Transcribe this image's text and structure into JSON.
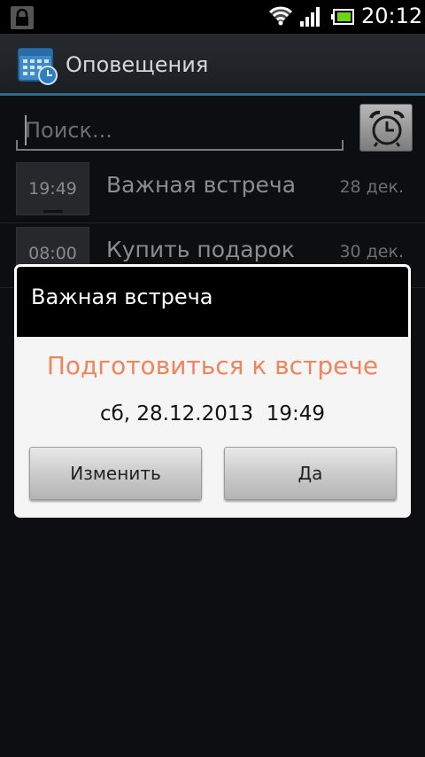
{
  "status_bar": {
    "time": "20:12",
    "icons": [
      "lock-icon",
      "wifi-icon",
      "signal-icon",
      "battery-icon"
    ]
  },
  "action_bar": {
    "title": "Оповещения",
    "icon": "calendar-clock-icon"
  },
  "search": {
    "placeholder": "Поиск...",
    "value": ""
  },
  "alarm_button": {
    "icon": "alarm-clock-icon"
  },
  "notifications": [
    {
      "time": "19:49",
      "title": "Важная встреча",
      "date": "28 дек."
    },
    {
      "time": "08:00",
      "title": "Купить подарок",
      "date": "30 дек."
    }
  ],
  "dialog": {
    "title": "Важная встреча",
    "heading": "Подготовиться к встрече",
    "datetime": "сб, 28.12.2013  19:49",
    "edit_label": "Изменить",
    "ok_label": "Да"
  },
  "colors": {
    "accent_line": "#2a6c8c",
    "dialog_heading": "#f0845c"
  }
}
